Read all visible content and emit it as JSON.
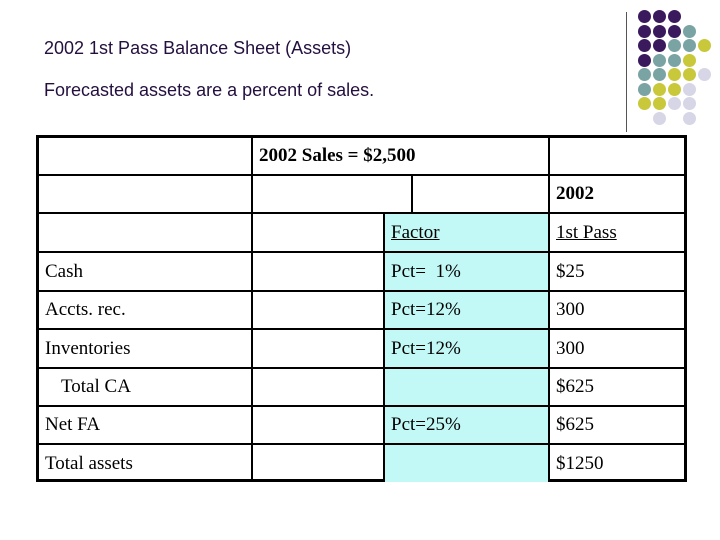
{
  "slide": {
    "title": "2002 1st Pass Balance Sheet (Assets)",
    "subtitle": "Forecasted assets are a percent of sales."
  },
  "decoration": {
    "colors": {
      "purple": "#3a1a5c",
      "teal": "#7aa3a3",
      "olive": "#c8c83a",
      "lavender": "#d6d6e6"
    }
  },
  "table": {
    "sales_header": "2002 Sales = $2,500",
    "year_header": "2002",
    "factor_header": "Factor",
    "first_pass_header": "1st Pass",
    "factor_column_color": "#c2f8f5",
    "rows": [
      {
        "label": "Cash",
        "factor": "Pct=  1%",
        "value": "$25"
      },
      {
        "label": "Accts. rec.",
        "factor": "Pct=12%",
        "value": "300"
      },
      {
        "label": "Inventories",
        "factor": "Pct=12%",
        "value": "300"
      },
      {
        "label": "Total CA",
        "factor": "",
        "value": "$625"
      },
      {
        "label": "Net FA",
        "factor": "Pct=25%",
        "value": "$625"
      },
      {
        "label": "Total assets",
        "factor": "",
        "value": "$1250"
      }
    ]
  }
}
